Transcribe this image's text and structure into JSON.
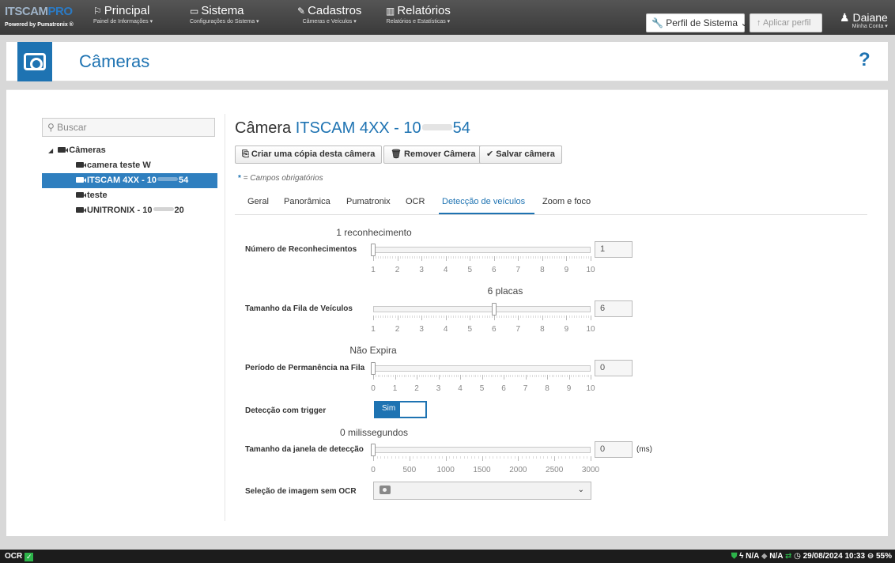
{
  "logo": {
    "brand_a": "ITSCAM",
    "brand_b": "PRO",
    "powered": "Powered by Pumatronix ®"
  },
  "nav": [
    {
      "icon": "⚐",
      "title": "Principal",
      "sub": "Painel de Informações ▾"
    },
    {
      "icon": "▭",
      "title": "Sistema",
      "sub": "Configurações do Sistema ▾"
    },
    {
      "icon": "✎",
      "title": "Cadastros",
      "sub": "Câmeras e Veículos ▾"
    },
    {
      "icon": "▥",
      "title": "Relatórios",
      "sub": "Relatórios e Estatísticas ▾"
    }
  ],
  "profile": {
    "select_label": "Perfil de Sistema",
    "apply_label": "Aplicar perfil"
  },
  "user": {
    "name": "Daiane",
    "sub": "Minha Conta ▾"
  },
  "header": {
    "title": "Câmeras",
    "help": "?"
  },
  "sidebar": {
    "search_placeholder": "Buscar",
    "root": "Câmeras",
    "items": [
      {
        "label": "camera teste W"
      },
      {
        "label_a": "ITSCAM 4XX - 10",
        "label_b": "54"
      },
      {
        "label": "teste"
      },
      {
        "label_a": "UNITRONIX - 10",
        "label_b": "20"
      }
    ]
  },
  "camera": {
    "prefix": "Câmera ",
    "name_a": "ITSCAM 4XX - 10",
    "name_b": "54"
  },
  "toolbar": {
    "copy": "Criar uma cópia desta câmera",
    "remove": "Remover Câmera",
    "save": "Salvar câmera"
  },
  "required_note": {
    "star": "*",
    "text": " = Campos obrigatórios"
  },
  "tabs": [
    "Geral",
    "Panorâmica",
    "Pumatronix",
    "OCR",
    "Detecção de veículos",
    "Zoom e foco"
  ],
  "active_tab": "Detecção de veículos",
  "fields": {
    "recognitions": {
      "label": "Número de Reconhecimentos",
      "caption": "1 reconhecimento",
      "value": "1",
      "min": 1,
      "max": 10,
      "ticks": [
        "1",
        "2",
        "3",
        "4",
        "5",
        "6",
        "7",
        "8",
        "9",
        "10"
      ]
    },
    "queue": {
      "label": "Tamanho da Fila de Veículos",
      "caption": "6 placas",
      "value": "6",
      "min": 1,
      "max": 10,
      "ticks": [
        "1",
        "2",
        "3",
        "4",
        "5",
        "6",
        "7",
        "8",
        "9",
        "10"
      ]
    },
    "period": {
      "label": "Período de Permanência na Fila",
      "caption": "Não Expira",
      "value": "0",
      "min": 0,
      "max": 10,
      "ticks": [
        "0",
        "1",
        "2",
        "3",
        "4",
        "5",
        "6",
        "7",
        "8",
        "9",
        "10"
      ]
    },
    "trigger": {
      "label": "Detecção com trigger",
      "toggle": "Sim"
    },
    "window": {
      "label": "Tamanho da janela de detecção",
      "caption": "0 milissegundos",
      "value": "0",
      "unit": "(ms)",
      "min": 0,
      "max": 3000,
      "ticks": [
        "0",
        "500",
        "1000",
        "1500",
        "2000",
        "2500",
        "3000"
      ]
    },
    "image_sel": {
      "label": "Seleção de imagem sem OCR"
    }
  },
  "status": {
    "ocr": "OCR",
    "ok": "✓",
    "na1": "N/A",
    "na2": "N/A",
    "datetime": "29/08/2024 10:33",
    "disk": "55%"
  }
}
